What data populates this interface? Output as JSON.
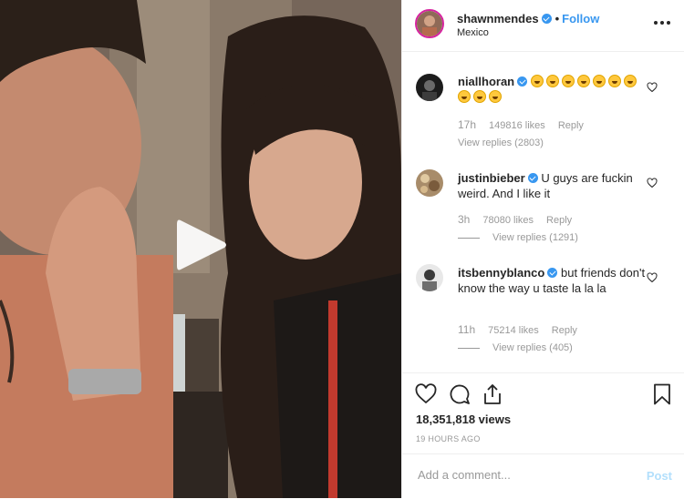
{
  "post": {
    "username": "shawnmendes",
    "dot": "•",
    "follow_label": "Follow",
    "location": "Mexico"
  },
  "comments": [
    {
      "username": "niallhoran",
      "verified": true,
      "text": "",
      "emoji_count": 10,
      "emoji_icon": "grinning-squinting-face-emoji",
      "time": "17h",
      "likes": "149816 likes",
      "reply": "Reply",
      "view_replies": "View replies (2803)"
    },
    {
      "username": "justinbieber",
      "verified": true,
      "text": "U guys are fuckin weird. And I like it",
      "time": "3h",
      "likes": "78080 likes",
      "reply": "Reply",
      "view_replies": "View replies (1291)"
    },
    {
      "username": "itsbennyblanco",
      "verified": true,
      "text": "but friends don't know the way u taste la la la",
      "time": "11h",
      "likes": "75214 likes",
      "reply": "Reply",
      "view_replies": "View replies (405)"
    }
  ],
  "stats": {
    "views": "18,351,818 views",
    "posted": "19 HOURS AGO"
  },
  "add_comment": {
    "placeholder": "Add a comment...",
    "post_label": "Post"
  },
  "colors": {
    "link_blue": "#3897f0",
    "post_disabled": "#b2dffc",
    "muted": "#999999"
  },
  "icons": [
    "play-icon",
    "more-options-icon",
    "heart-icon",
    "comment-icon",
    "share-icon",
    "bookmark-icon",
    "verified-badge-icon"
  ]
}
